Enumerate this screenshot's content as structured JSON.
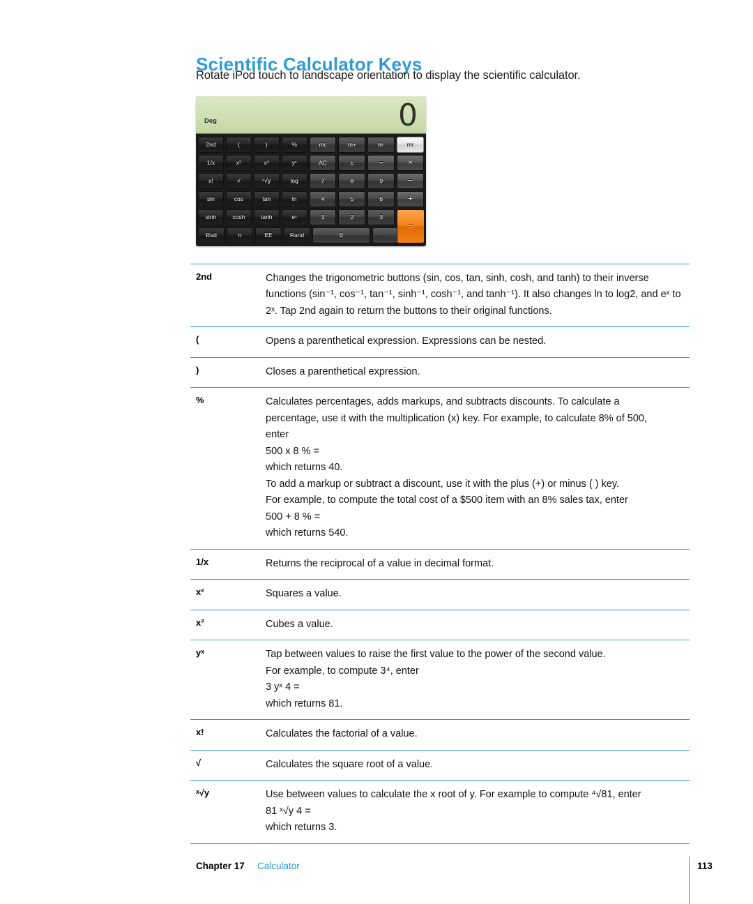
{
  "page": {
    "title": "Scientific Calculator Keys",
    "intro": "Rotate iPod touch to landscape orientation to display the scientific calculator.",
    "accent_color": "#2e9bd6"
  },
  "calculator": {
    "mode_label": "Deg",
    "display_value": "0",
    "rows": [
      [
        "2nd",
        "(",
        ")",
        "%",
        "mc",
        "m+",
        "m-",
        "mr"
      ],
      [
        "1/x",
        "x²",
        "x³",
        "yˣ",
        "AC",
        "±",
        "÷",
        "×"
      ],
      [
        "x!",
        "√",
        "ˣ√y",
        "log",
        "7",
        "8",
        "9",
        "−"
      ],
      [
        "sin",
        "cos",
        "tan",
        "ln",
        "4",
        "5",
        "6",
        "+"
      ],
      [
        "sinh",
        "cosh",
        "tanh",
        "eˣ",
        "1",
        "2",
        "3",
        "="
      ],
      [
        "Rad",
        "π",
        "EE",
        "Rand",
        "0",
        "."
      ]
    ]
  },
  "key_table": [
    {
      "key": "2nd",
      "lines": [
        "Changes the trigonometric buttons (sin, cos, tan, sinh, cosh, and tanh) to their inverse",
        "functions (sin⁻¹, cos⁻¹, tan⁻¹, sinh⁻¹, cosh⁻¹, and tanh⁻¹). It also changes ln to log2, and eˣ to",
        "2ˣ. Tap 2nd again to return the buttons to their original functions."
      ]
    },
    {
      "key": "(",
      "lines": [
        "Opens a parenthetical expression. Expressions can be nested."
      ]
    },
    {
      "key": ")",
      "lines": [
        "Closes a parenthetical expression."
      ]
    },
    {
      "key": "%",
      "lines": [
        "Calculates percentages, adds markups, and subtracts discounts. To calculate a",
        "percentage, use it with the multiplication (x) key. For example, to calculate 8% of 500,",
        "enter",
        "500 x 8 % =",
        "which returns 40.",
        "To add a markup or subtract a discount, use it with the plus (+) or minus ( ) key.",
        "For example, to compute the total cost of a $500 item with an 8% sales tax, enter",
        "500 + 8 % =",
        "which returns 540."
      ]
    },
    {
      "key": "1/x",
      "lines": [
        "Returns the reciprocal of a value in decimal format."
      ]
    },
    {
      "key": "x²",
      "lines": [
        "Squares a value."
      ]
    },
    {
      "key": "x³",
      "lines": [
        "Cubes a value."
      ]
    },
    {
      "key": "yˣ",
      "lines": [
        "Tap between values to raise the first value to the power of the second value.",
        "For example, to compute 3⁴, enter",
        "3 yˣ 4 =",
        "which returns 81."
      ]
    },
    {
      "key": "x!",
      "lines": [
        "Calculates the factorial of a value."
      ]
    },
    {
      "key": "√",
      "lines": [
        "Calculates the square root of a value."
      ]
    },
    {
      "key": "ˣ√y",
      "lines": [
        "Use between values to calculate the x root of y. For example to compute ⁴√81, enter",
        "81 ˣ√y 4 =",
        "which returns 3."
      ]
    }
  ],
  "footer": {
    "chapter": "Chapter 17",
    "section": "Calculator",
    "page_number": "113"
  }
}
